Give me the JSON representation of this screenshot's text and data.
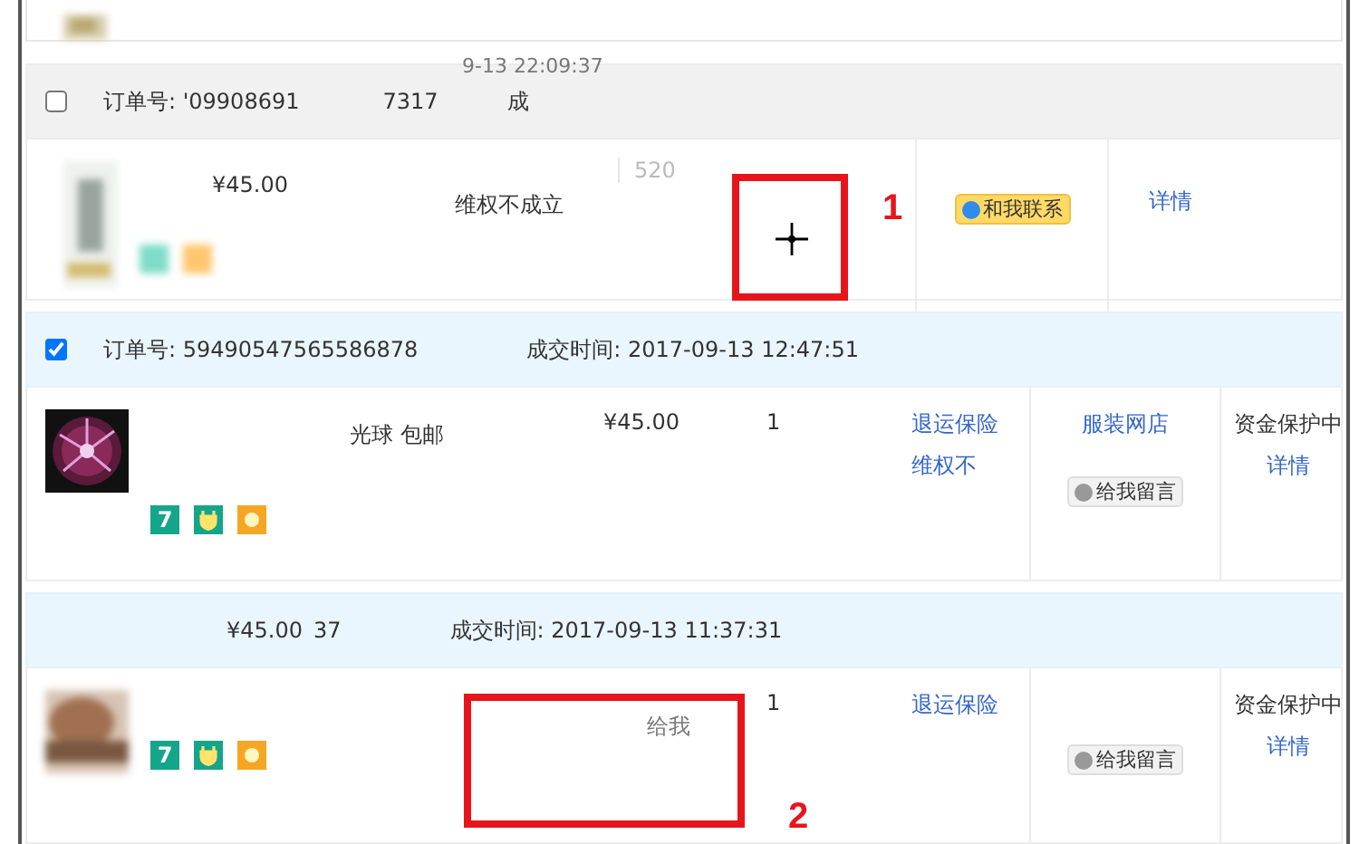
{
  "orders": [
    {
      "kind": "faded",
      "checked": false,
      "highlighted": false,
      "order_no": "订单号: '09908691",
      "order_tail": "7317",
      "time_above": "9-13 22:09:37",
      "time": "成",
      "price": "¥45.00",
      "services": [
        "维权不成立"
      ],
      "faded_note": "520",
      "contact": "和我联系",
      "detail": "详情",
      "badges": [
        {
          "kind": "green"
        },
        {
          "kind": "orange"
        }
      ]
    },
    {
      "kind": "full",
      "checked": true,
      "highlighted": true,
      "order_no": "订单号: 59490547565586878",
      "time": "成交时间: 2017-09-13 12:47:51",
      "title": "光球 包邮",
      "price": "¥45.00",
      "qty": "1",
      "services": [
        "退运保险",
        "维权不"
      ],
      "seller": "服装网店",
      "message": "给我留言",
      "status": "资金保护中",
      "detail": "详情",
      "badges": [
        {
          "kind": "seven",
          "label": "7"
        },
        {
          "kind": "plug"
        },
        {
          "kind": "sun"
        }
      ]
    },
    {
      "kind": "full",
      "highlighted": true,
      "header_price": "¥45.00",
      "order_tail": "37",
      "time": "成交时间: 2017-09-13 11:37:31",
      "faded_note": "给我",
      "qty": "1",
      "services": [
        "退运保险"
      ],
      "message": "给我留言",
      "status": "资金保护中",
      "detail": "详情",
      "badges": [
        {
          "kind": "seven",
          "label": "7"
        },
        {
          "kind": "plug"
        },
        {
          "kind": "sun"
        }
      ]
    }
  ],
  "annotations": [
    {
      "label": "1"
    },
    {
      "label": "2"
    }
  ]
}
